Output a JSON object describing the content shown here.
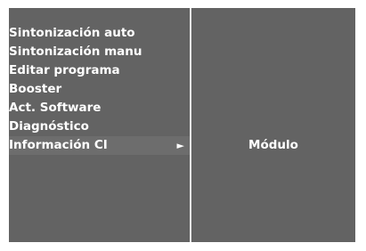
{
  "menu": {
    "items": [
      {
        "label": "Sintonización auto"
      },
      {
        "label": "Sintonización manu"
      },
      {
        "label": "Editar programa"
      },
      {
        "label": "Booster"
      },
      {
        "label": "Act. Software"
      },
      {
        "label": "Diagnóstico"
      },
      {
        "label": "Información CI",
        "arrow": "►",
        "selected": true
      }
    ]
  },
  "submenu": {
    "items": [
      {
        "label": "Módulo"
      }
    ]
  },
  "colors": {
    "panel_background": "#636363",
    "divider": "#e6e6e6",
    "text": "#ffffff"
  }
}
